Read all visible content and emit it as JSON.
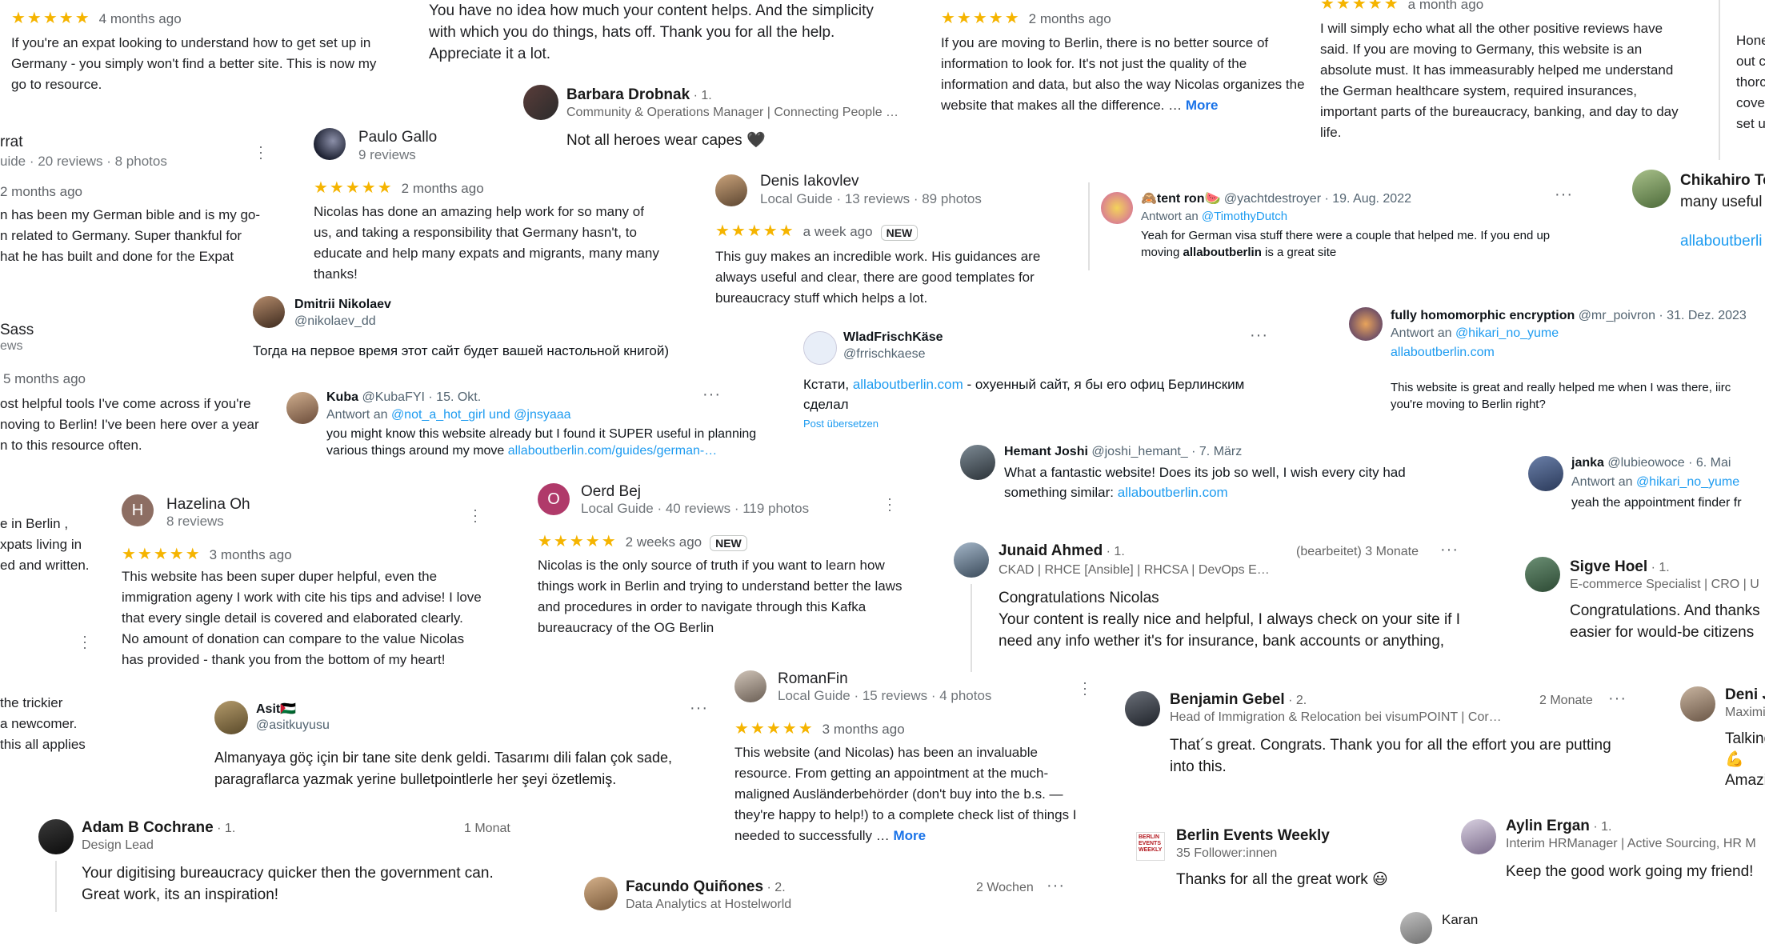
{
  "colors": {
    "star": "#f5b400",
    "link": "#1a73e8",
    "twitter_link": "#1d9bf0"
  },
  "stars": "★★★★★",
  "more_label": "More",
  "new_badge": "NEW",
  "c1": {
    "ago": "4 months ago",
    "text": "If you're an expat looking to understand how to get set up in Germany - you simply won't find a better site. This is now my go to resource."
  },
  "c2": {
    "text": "You have no idea how much your content helps. And the simplicity with which you do things, hats off. Thank you for all the help. Appreciate it a lot."
  },
  "c3": {
    "ago": "2 months ago",
    "text": "If you are moving to Berlin, there is no better source of information to look for. It's not just the quality of the information and data, but also the way Nicolas organizes the website that makes all the difference. …"
  },
  "c4": {
    "ago": "a month ago",
    "text": "I will simply echo what all the other positive reviews have said. If you are moving to Germany, this website is an absolute must. It has immeasurably helped me understand the German healthcare system, required insurances, important parts of the bureaucracy, banking, and day to day life."
  },
  "c5": {
    "lines": [
      "Hone",
      "out c",
      "thorc",
      "cove",
      "set u"
    ]
  },
  "barbara": {
    "name": "Barbara Drobnak",
    "degree": "· 1.",
    "title": "Community & Operations Manager | Connecting People …",
    "text": "Not all heroes wear capes 🖤"
  },
  "paulo": {
    "name": "Paulo Gallo",
    "reviews": "9 reviews",
    "ago": "2 months ago",
    "text": "Nicolas has done an amazing help work for so many of us, and taking a responsibility that Germany hasn't, to educate and help many expats and migrants, many many thanks!"
  },
  "rrat": {
    "name": "rrat",
    "meta": "uide · 20 reviews · 8 photos",
    "ago": "2 months ago",
    "lines": [
      "n has been my German bible and is my go-",
      "n related to Germany. Super thankful for",
      "hat he has built and done for the Expat"
    ]
  },
  "denis": {
    "name": "Denis Iakovlev",
    "meta": "Local Guide · 13 reviews · 89 photos",
    "ago": "a week ago",
    "text": "This guy makes an incredible work. His guidances are always useful and clear, there are good templates for bureaucracy stuff which helps a lot."
  },
  "tentron": {
    "name": "🙈tent ron🍉",
    "handle": "@yachtdestroyer · 19. Aug. 2022",
    "reply_prefix": "Antwort an",
    "reply_to": "@TimothyDutch",
    "text_before": "Yeah for German visa stuff there were a couple that helped me. If you end up moving",
    "text_bold": "allaboutberlin",
    "text_after": "is a great site"
  },
  "chikahiro": {
    "name": "Chikahiro To",
    "text": "many useful",
    "link": "allaboutberli"
  },
  "dmitrii": {
    "name": "Dmitrii Nikolaev",
    "handle": "@nikolaev_dd",
    "text": "Тогда на первое время этот сайт будет вашей настольной книгой)"
  },
  "sass": {
    "name": "Sass",
    "meta": "ews",
    "ago": "5 months ago",
    "lines": [
      "ost helpful tools I've come across if you're",
      "noving to Berlin! I've been here over a year",
      "n to this resource often."
    ]
  },
  "wlad": {
    "name": "WladFrischKäse",
    "handle": "@frrischkaese",
    "text_before": "Кстати,",
    "link": "allaboutberlin.com",
    "text_after": "- охуенный сайт, я бы его офиц Берлинским сделал",
    "translate": "Post übersetzen"
  },
  "fhe": {
    "name": "fully homomorphic encryption",
    "handle": "@mr_poivron · 31. Dez. 2023",
    "reply_prefix": "Antwort an",
    "reply_to": "@hikari_no_yume",
    "link": "allaboutberlin.com",
    "text": "This website is great and really helped me when I was there, iirc you're moving to Berlin right?"
  },
  "kuba": {
    "name": "Kuba",
    "handle": "@KubaFYI · 15. Okt.",
    "reply_prefix": "Antwort an",
    "reply_to": "@not_a_hot_girl und @jnsyaaa",
    "text": "you might know this website already but I found it SUPER useful in planning various things around my move",
    "link": "allaboutberlin.com/guides/german-…"
  },
  "hemant": {
    "name": "Hemant Joshi",
    "handle": "@joshi_hemant_ · 7. März",
    "text": "What a fantastic website! Does its job so well, I wish every city had something similar:",
    "link": "allaboutberlin.com"
  },
  "janka": {
    "name": "janka",
    "handle": "@lubieowoce · 6. Mai",
    "reply_prefix": "Antwort an",
    "reply_to": "@hikari_no_yume",
    "text": "yeah the appointment finder fr"
  },
  "hazelina": {
    "name": "Hazelina Oh",
    "reviews": "8 reviews",
    "ago": "3 months ago",
    "text": "This website has been super duper helpful, even the immigration ageny I work with cite his tips and advise! I love that every single detail is covered and elaborated clearly. No amount of donation can compare to the value Nicolas has provided - thank you from the bottom of my heart!"
  },
  "left2": {
    "lines": [
      "e in Berlin ,",
      "xpats living in",
      "ed and written."
    ]
  },
  "oerd": {
    "name": "Oerd Bej",
    "meta": "Local Guide · 40 reviews · 119 photos",
    "ago": "2 weeks ago",
    "text": "Nicolas is the only source of truth if you want to learn how things work in Berlin and trying to understand better the laws and procedures in order to navigate through this Kafka bureaucracy of  the OG Berlin"
  },
  "junaid": {
    "name": "Junaid Ahmed",
    "degree": "· 1.",
    "edited": "(bearbeitet) 3 Monate",
    "title": "CKAD | RHCE [Ansible] | RHCSA | DevOps E…",
    "text": "Congratulations Nicolas\nYour content is really nice and helpful, I always check on your site if I need any info wether it's for insurance, bank accounts or anything,"
  },
  "sigve": {
    "name": "Sigve Hoel",
    "degree": "· 1.",
    "title": "E-commerce Specialist | CRO | U",
    "text": "Congratulations. And thanks easier for would-be citizens"
  },
  "left3": {
    "lines": [
      "the trickier",
      "a newcomer.",
      "this all applies"
    ]
  },
  "asit": {
    "name": "Asit🇵🇸",
    "handle": "@asitkuyusu",
    "text": "Almanyaya göç için bir tane site denk geldi. Tasarımı dili falan çok sade, paragraflarca yazmak yerine bulletpointlerle her şeyi özetlemiş."
  },
  "roman": {
    "name": "RomanFin",
    "meta": "Local Guide · 15 reviews · 4 photos",
    "ago": "3 months ago",
    "text": "This website (and Nicolas) has been an invaluable resource. From getting an appointment at the much-maligned Ausländerbehörder (don't buy into the b.s. — they're happy to help!) to a complete check list of things I needed to successfully …"
  },
  "benjamin": {
    "name": "Benjamin Gebel",
    "degree": "· 2.",
    "time": "2 Monate",
    "title": "Head of Immigration & Relocation bei visumPOINT | Cor…",
    "text": "That´s great. Congrats. Thank you for all the effort you are putting into this."
  },
  "deni": {
    "name": "Deni J",
    "title": "Maximi",
    "lines": [
      "Talking",
      "💪",
      "Amazi"
    ]
  },
  "adam": {
    "name": "Adam B Cochrane",
    "degree": "· 1.",
    "time": "1 Monat",
    "title": "Design Lead",
    "text": "Your digitising bureaucracy quicker then the government can. Great work, its an inspiration!"
  },
  "berlinevents": {
    "name": "Berlin Events Weekly",
    "followers": "35 Follower:innen",
    "logo": "BERLIN EVENTS WEEKLY",
    "text": "Thanks for all the great work 😃"
  },
  "aylin": {
    "name": "Aylin Ergan",
    "degree": "· 1.",
    "title": "Interim HRManager | Active Sourcing, HR M",
    "text": "Keep the good work going my friend!"
  },
  "facundo": {
    "name": "Facundo Quiñones",
    "degree": "· 2.",
    "time": "2 Wochen",
    "title": "Data Analytics at Hostelworld"
  },
  "karan": {
    "name": "Karan"
  }
}
